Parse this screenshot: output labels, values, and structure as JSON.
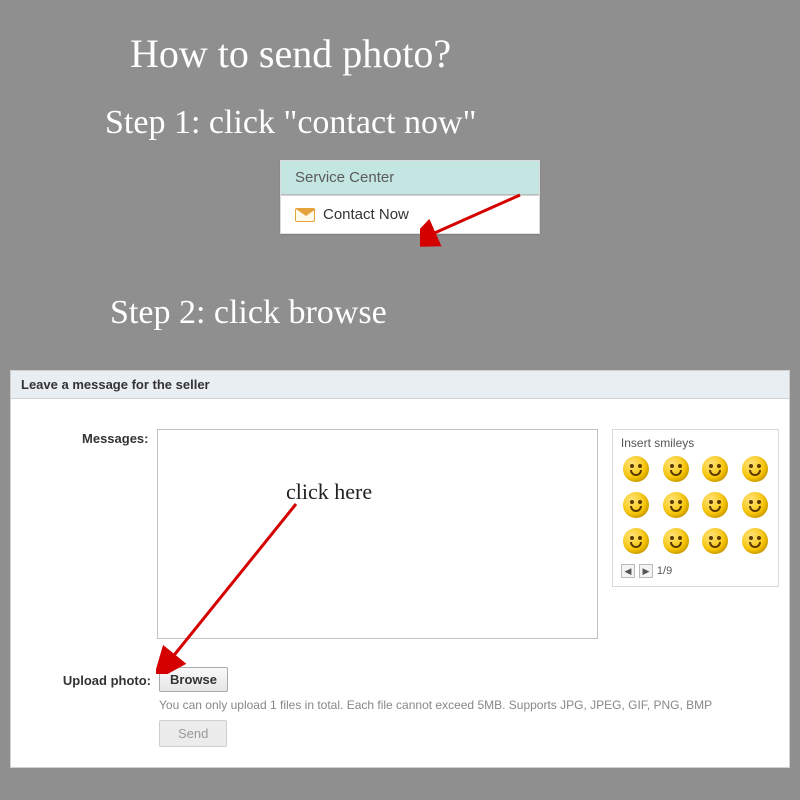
{
  "title": "How to send photo?",
  "step1": "Step 1: click \"contact now\"",
  "step2": "Step 2: click browse",
  "service_center": {
    "header": "Service Center",
    "contact_label": "Contact Now"
  },
  "message_panel": {
    "title": "Leave a message for the seller",
    "messages_label": "Messages:",
    "upload_label": "Upload photo:",
    "browse_label": "Browse",
    "hint": "You can only upload 1 files in total. Each file cannot exceed 5MB. Supports JPG, JPEG, GIF, PNG, BMP",
    "send_label": "Send",
    "click_here": "click here",
    "smileys": {
      "title": "Insert smileys",
      "page": "1/9",
      "prev": "◀",
      "next": "▶"
    }
  }
}
